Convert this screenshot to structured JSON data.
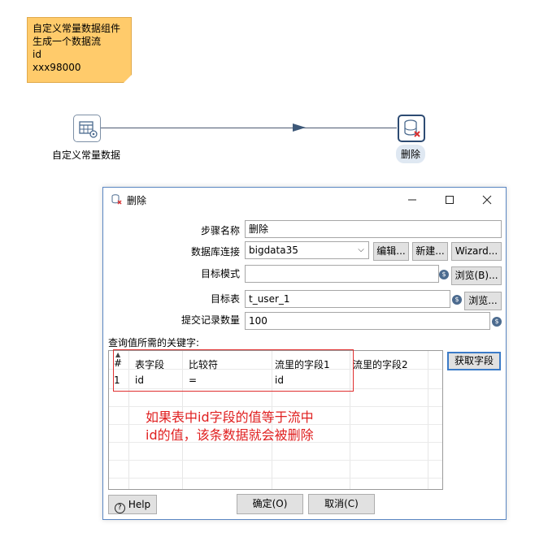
{
  "note": {
    "lines": [
      "自定义常量数据组件",
      "生成一个数据流",
      "id",
      "xxx98000"
    ]
  },
  "canvas": {
    "step1_label": "自定义常量数据",
    "step2_label": "删除"
  },
  "dialog": {
    "title": "删除",
    "fields": {
      "step_name_label": "步骤名称",
      "step_name_value": "删除",
      "connection_label": "数据库连接",
      "connection_value": "bigdata35",
      "edit_label": "编辑...",
      "new_label": "新建...",
      "wizard_label": "Wizard...",
      "schema_label": "目标模式",
      "schema_value": "",
      "browse_schema_label": "浏览(B)...",
      "table_label": "目标表",
      "table_value": "t_user_1",
      "browse_table_label": "浏览...",
      "commit_label": "提交记录数量",
      "commit_value": "100"
    },
    "keys_label": "查询值所需的关键字:",
    "get_fields_label": "获取字段",
    "table": {
      "headers": [
        "#",
        "表字段",
        "比较符",
        "流里的字段1",
        "流里的字段2"
      ],
      "rows": [
        [
          "1",
          "id",
          "=",
          "id",
          ""
        ]
      ]
    },
    "annotation": {
      "line1": "如果表中id字段的值等于流中",
      "line2": "id的值，该条数据就会被删除"
    },
    "help_label": "Help",
    "ok_label": "确定(O)",
    "cancel_label": "取消(C)",
    "colors": {
      "note": "#ffcb6b",
      "accent": "#3b7bc8",
      "annotation": "#e02020"
    }
  }
}
